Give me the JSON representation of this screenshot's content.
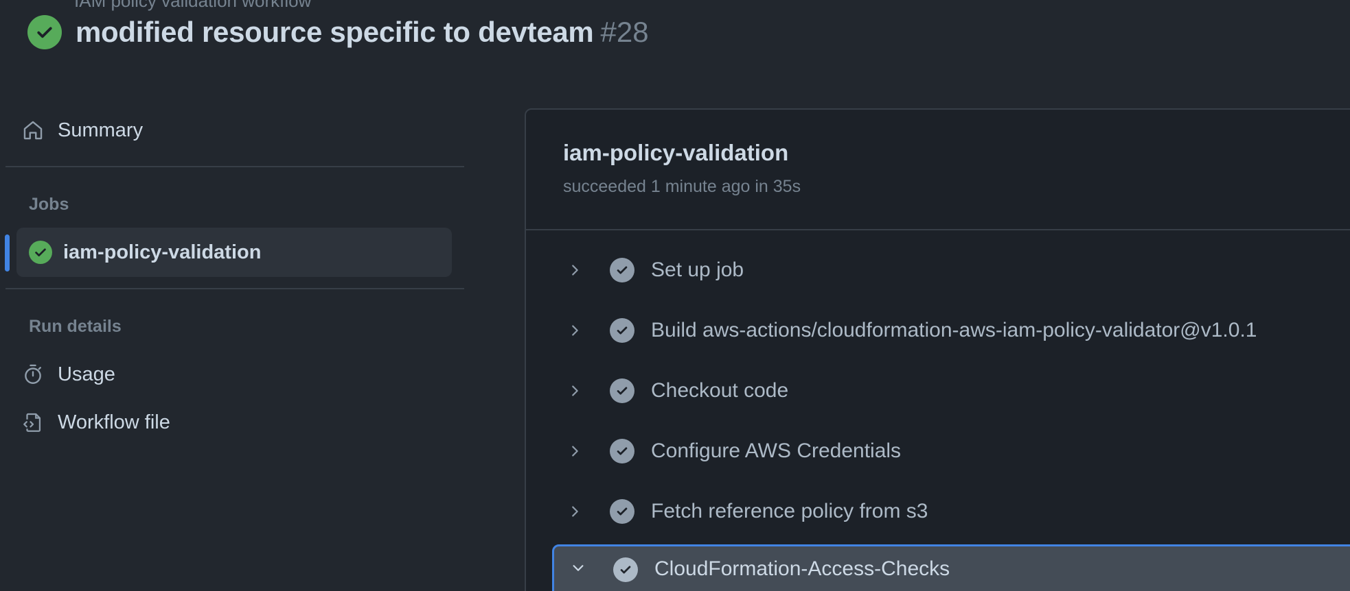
{
  "header": {
    "breadcrumb": "IAM policy validation workflow",
    "title": "modified resource specific to devteam",
    "run_number": "#28",
    "status": "success"
  },
  "sidebar": {
    "summary_label": "Summary",
    "jobs_heading": "Jobs",
    "jobs": [
      {
        "label": "iam-policy-validation",
        "status": "success",
        "active": true
      }
    ],
    "run_details_heading": "Run details",
    "run_details": [
      {
        "label": "Usage",
        "icon": "stopwatch-icon"
      },
      {
        "label": "Workflow file",
        "icon": "file-code-icon"
      }
    ]
  },
  "job": {
    "title": "iam-policy-validation",
    "status_text": "succeeded 1 minute ago in 35s",
    "steps": [
      {
        "label": "Set up job",
        "expanded": false
      },
      {
        "label": "Build aws-actions/cloudformation-aws-iam-policy-validator@v1.0.1",
        "expanded": false
      },
      {
        "label": "Checkout code",
        "expanded": false
      },
      {
        "label": "Configure AWS Credentials",
        "expanded": false
      },
      {
        "label": "Fetch reference policy from s3",
        "expanded": false
      },
      {
        "label": "CloudFormation-Access-Checks",
        "expanded": true
      }
    ]
  },
  "colors": {
    "success": "#57ab5a",
    "accent": "#4184e4",
    "background": "#22272e",
    "panel": "#1c2128"
  }
}
